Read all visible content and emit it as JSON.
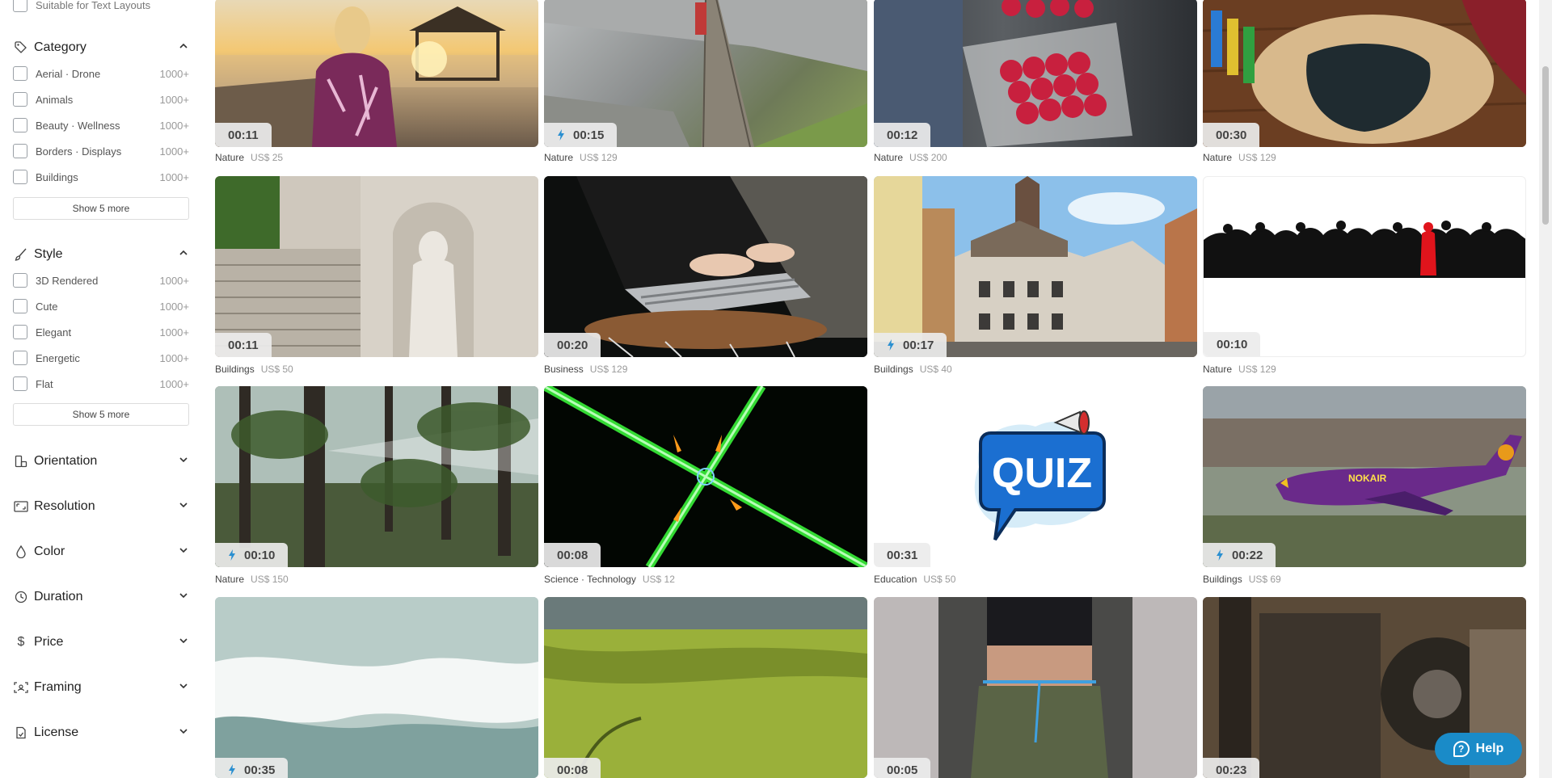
{
  "sidebar": {
    "top_partial": "Suitable for Text Layouts",
    "category": {
      "title": "Category",
      "items": [
        {
          "label": "Aerial · Drone",
          "count": "1000+"
        },
        {
          "label": "Animals",
          "count": "1000+"
        },
        {
          "label": "Beauty · Wellness",
          "count": "1000+"
        },
        {
          "label": "Borders · Displays",
          "count": "1000+"
        },
        {
          "label": "Buildings",
          "count": "1000+"
        }
      ],
      "show_more": "Show 5 more"
    },
    "style": {
      "title": "Style",
      "items": [
        {
          "label": "3D Rendered",
          "count": "1000+"
        },
        {
          "label": "Cute",
          "count": "1000+"
        },
        {
          "label": "Elegant",
          "count": "1000+"
        },
        {
          "label": "Energetic",
          "count": "1000+"
        },
        {
          "label": "Flat",
          "count": "1000+"
        }
      ],
      "show_more": "Show 5 more"
    },
    "collapsed": [
      "Orientation",
      "Resolution",
      "Color",
      "Duration",
      "Price",
      "Framing",
      "License"
    ]
  },
  "cards": [
    {
      "duration": "00:11",
      "fast": false,
      "category": "Nature",
      "price": "US$ 25"
    },
    {
      "duration": "00:15",
      "fast": true,
      "category": "Nature",
      "price": "US$ 129"
    },
    {
      "duration": "00:12",
      "fast": false,
      "category": "Nature",
      "price": "US$ 200"
    },
    {
      "duration": "00:30",
      "fast": false,
      "category": "Nature",
      "price": "US$ 129"
    },
    {
      "duration": "00:11",
      "fast": false,
      "category": "Buildings",
      "price": "US$ 50"
    },
    {
      "duration": "00:20",
      "fast": false,
      "category": "Business",
      "price": "US$ 129"
    },
    {
      "duration": "00:17",
      "fast": true,
      "category": "Buildings",
      "price": "US$ 40"
    },
    {
      "duration": "00:10",
      "fast": false,
      "category": "Nature",
      "price": "US$ 129"
    },
    {
      "duration": "00:10",
      "fast": true,
      "category": "Nature",
      "price": "US$ 150"
    },
    {
      "duration": "00:08",
      "fast": false,
      "category": "Science · Technology",
      "price": "US$ 12"
    },
    {
      "duration": "00:31",
      "fast": false,
      "category": "Education",
      "price": "US$ 50"
    },
    {
      "duration": "00:22",
      "fast": true,
      "category": "Buildings",
      "price": "US$ 69"
    },
    {
      "duration": "00:35",
      "fast": true,
      "category": "",
      "price": ""
    },
    {
      "duration": "00:08",
      "fast": false,
      "category": "",
      "price": ""
    },
    {
      "duration": "00:05",
      "fast": false,
      "category": "",
      "price": ""
    },
    {
      "duration": "00:23",
      "fast": false,
      "category": "",
      "price": ""
    }
  ],
  "thumb_text": {
    "quiz": "QUIZ",
    "nokair": "NOKAIR"
  },
  "help": {
    "label": "Help"
  },
  "colors": {
    "accent": "#1a8bc8",
    "bolt": "#2a8fd0"
  }
}
